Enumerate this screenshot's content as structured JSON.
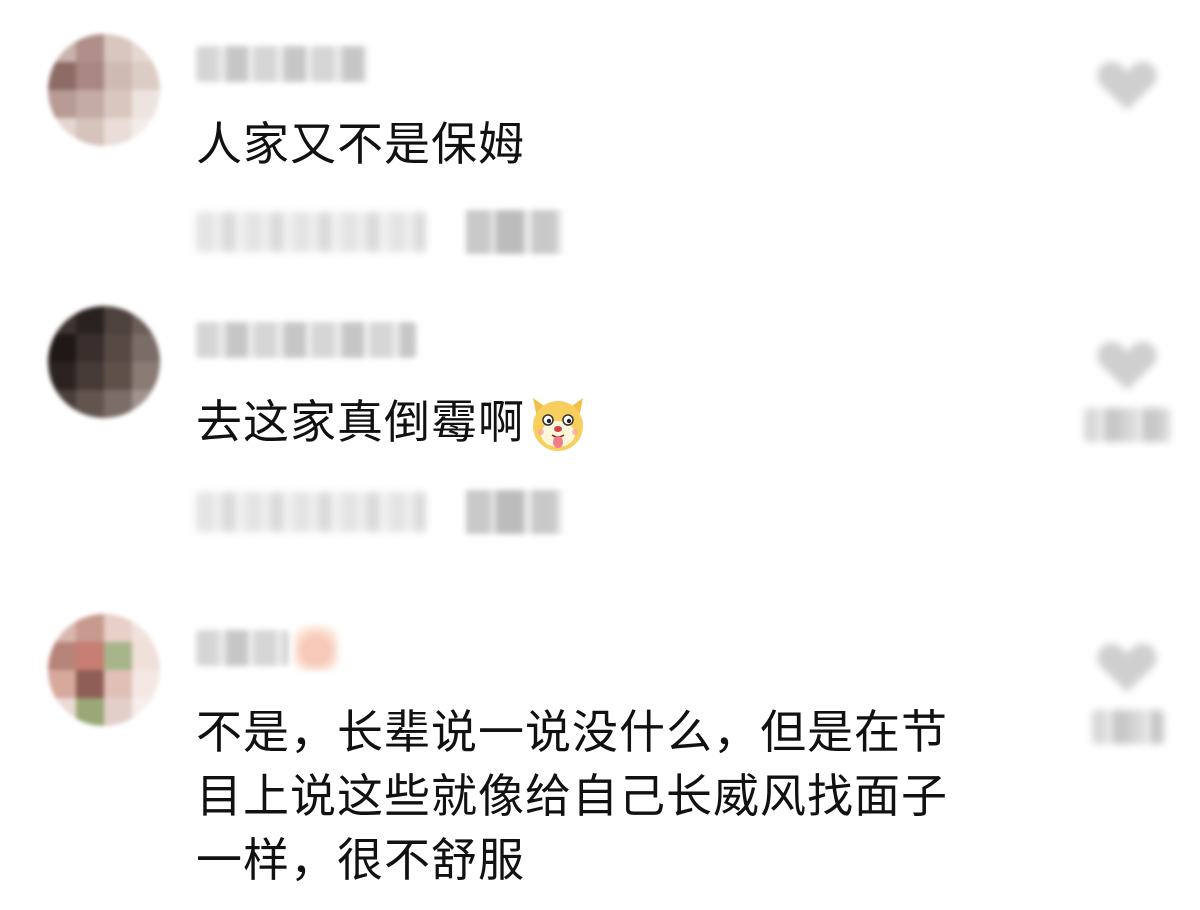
{
  "comments": [
    {
      "text": "人家又不是保姆",
      "colors": [
        "#c9b3ad",
        "#b08f8a",
        "#d8c6bf",
        "#e6d8d2",
        "#8e6c66",
        "#a98782",
        "#cfbab2",
        "#dcccc5",
        "#b79b94",
        "#c4aba4",
        "#d9c7bf",
        "#eee4df",
        "#e3d6d1",
        "#d5c3bc",
        "#e9ddd8",
        "#f3ecea"
      ]
    },
    {
      "text": "去这家真倒霉啊",
      "colors": [
        "#3e3431",
        "#2a2220",
        "#4e423e",
        "#6b5d58",
        "#1f1816",
        "#3a2f2c",
        "#574944",
        "#7a6c66",
        "#2c2320",
        "#473b37",
        "#5f504a",
        "#8a7b74",
        "#4a3e3a",
        "#62544f",
        "#7b6d67",
        "#a0938d"
      ]
    },
    {
      "text": "不是，长辈说一说没什么，但是在节目上说这些就像给自己长威风找面子一样，很不舒服",
      "lines": [
        "不是，长辈说一说没什么，但是在节",
        "目上说这些就像给自己长威风找面子",
        "一样，很不舒服"
      ],
      "colors": [
        "#d9b7ae",
        "#c8998f",
        "#e8cfc7",
        "#f1e1dc",
        "#b7847a",
        "#c77e73",
        "#a8b58a",
        "#efe0da",
        "#d7a89c",
        "#8f5e56",
        "#e0c0b6",
        "#f4e8e4",
        "#eadbd6",
        "#9aa776",
        "#e2cfc9",
        "#f7efec"
      ]
    }
  ],
  "emoji_name": "dog-emoji"
}
